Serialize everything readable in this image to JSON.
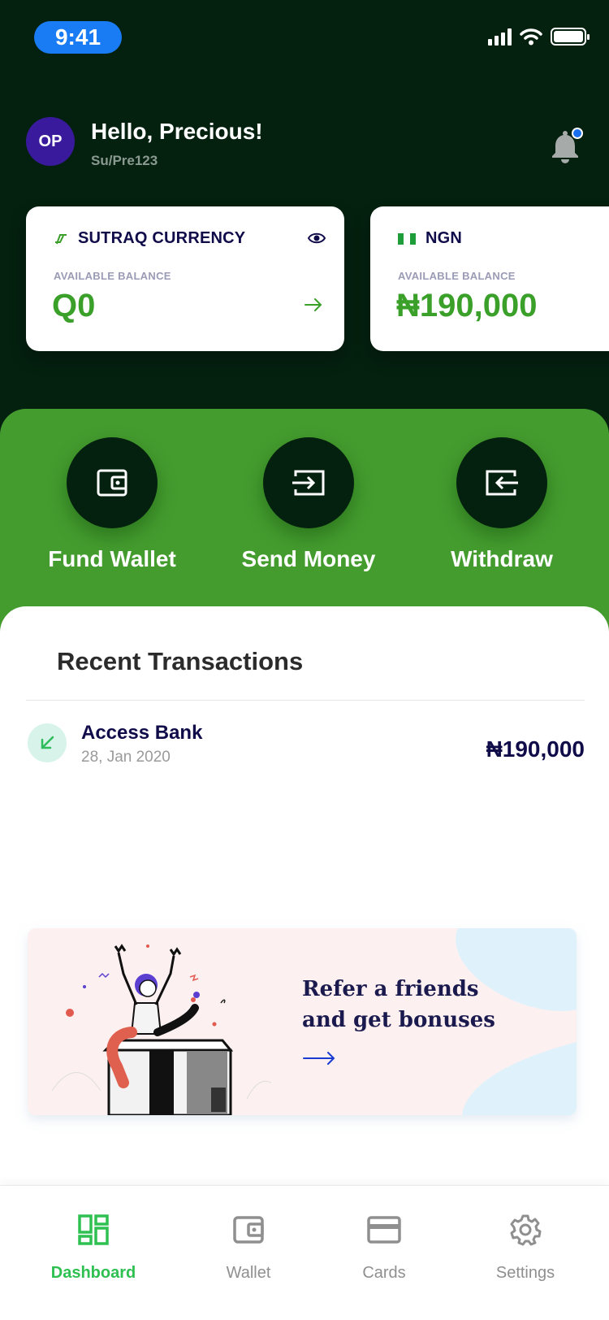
{
  "status_bar": {
    "time": "9:41",
    "icons": [
      "signal-icon",
      "wifi-icon",
      "battery-icon"
    ]
  },
  "header": {
    "avatar_initials": "OP",
    "greeting": "Hello, Precious!",
    "username": "Su/Pre123",
    "notification_icon": "bell-icon"
  },
  "balance_cards": [
    {
      "currency": "SUTRAQ CURRENCY",
      "available_label": "AVAILABLE BALANCE",
      "amount": "Q0",
      "icon": "sutraq-logo-icon"
    },
    {
      "currency": "NGN",
      "available_label": "AVAILABLE BALANCE",
      "amount": "₦190,000",
      "icon": "nigeria-flag-icon"
    }
  ],
  "actions": [
    {
      "label": "Fund Wallet",
      "icon": "wallet-icon"
    },
    {
      "label": "Send Money",
      "icon": "send-icon"
    },
    {
      "label": "Withdraw",
      "icon": "withdraw-icon"
    }
  ],
  "transactions": {
    "title": "Recent Transactions",
    "items": [
      {
        "name": "Access Bank",
        "date": "28, Jan 2020",
        "amount": "₦190,000",
        "direction": "incoming"
      }
    ]
  },
  "referral": {
    "line1": "Refer a friends",
    "line2": "and get bonuses"
  },
  "bottom_nav": [
    {
      "label": "Dashboard",
      "icon": "dashboard-icon",
      "active": true
    },
    {
      "label": "Wallet",
      "icon": "wallet-icon",
      "active": false
    },
    {
      "label": "Cards",
      "icon": "card-icon",
      "active": false
    },
    {
      "label": "Settings",
      "icon": "gear-icon",
      "active": false
    }
  ],
  "colors": {
    "dark_green": "#04200f",
    "brand_green": "#449c2e",
    "amount_green": "#3aa02a",
    "navy": "#100c4a",
    "nav_active": "#2ec050"
  }
}
